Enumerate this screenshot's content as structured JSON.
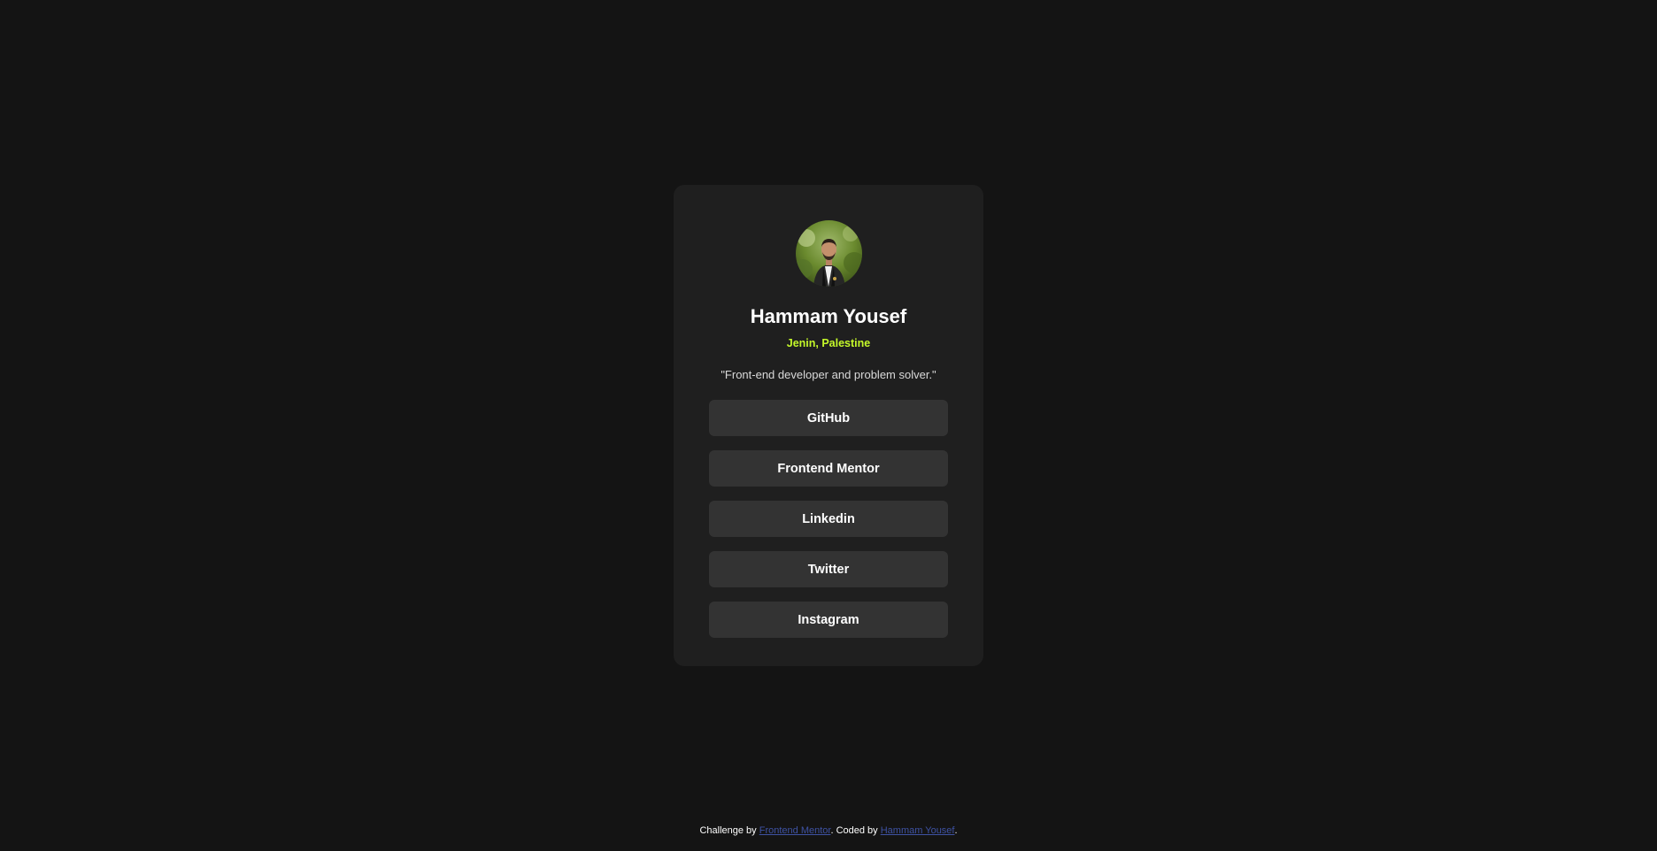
{
  "profile": {
    "name": "Hammam Yousef",
    "location": "Jenin, Palestine",
    "bio": "\"Front-end developer and problem solver.\"",
    "avatar_icon": "profile-photo",
    "accent_color": "#c4f82a"
  },
  "links": [
    {
      "label": "GitHub"
    },
    {
      "label": "Frontend Mentor"
    },
    {
      "label": "Linkedin"
    },
    {
      "label": "Twitter"
    },
    {
      "label": "Instagram"
    }
  ],
  "colors": {
    "page_background": "#141414",
    "card_background": "#1f1f1f",
    "button_background": "#333333",
    "attribution_link": "#3e52a3"
  },
  "attribution": {
    "prefix": "Challenge by ",
    "challenge_link": "Frontend Mentor",
    "middle": ". Coded by ",
    "author_link": "Hammam Yousef",
    "suffix": "."
  }
}
